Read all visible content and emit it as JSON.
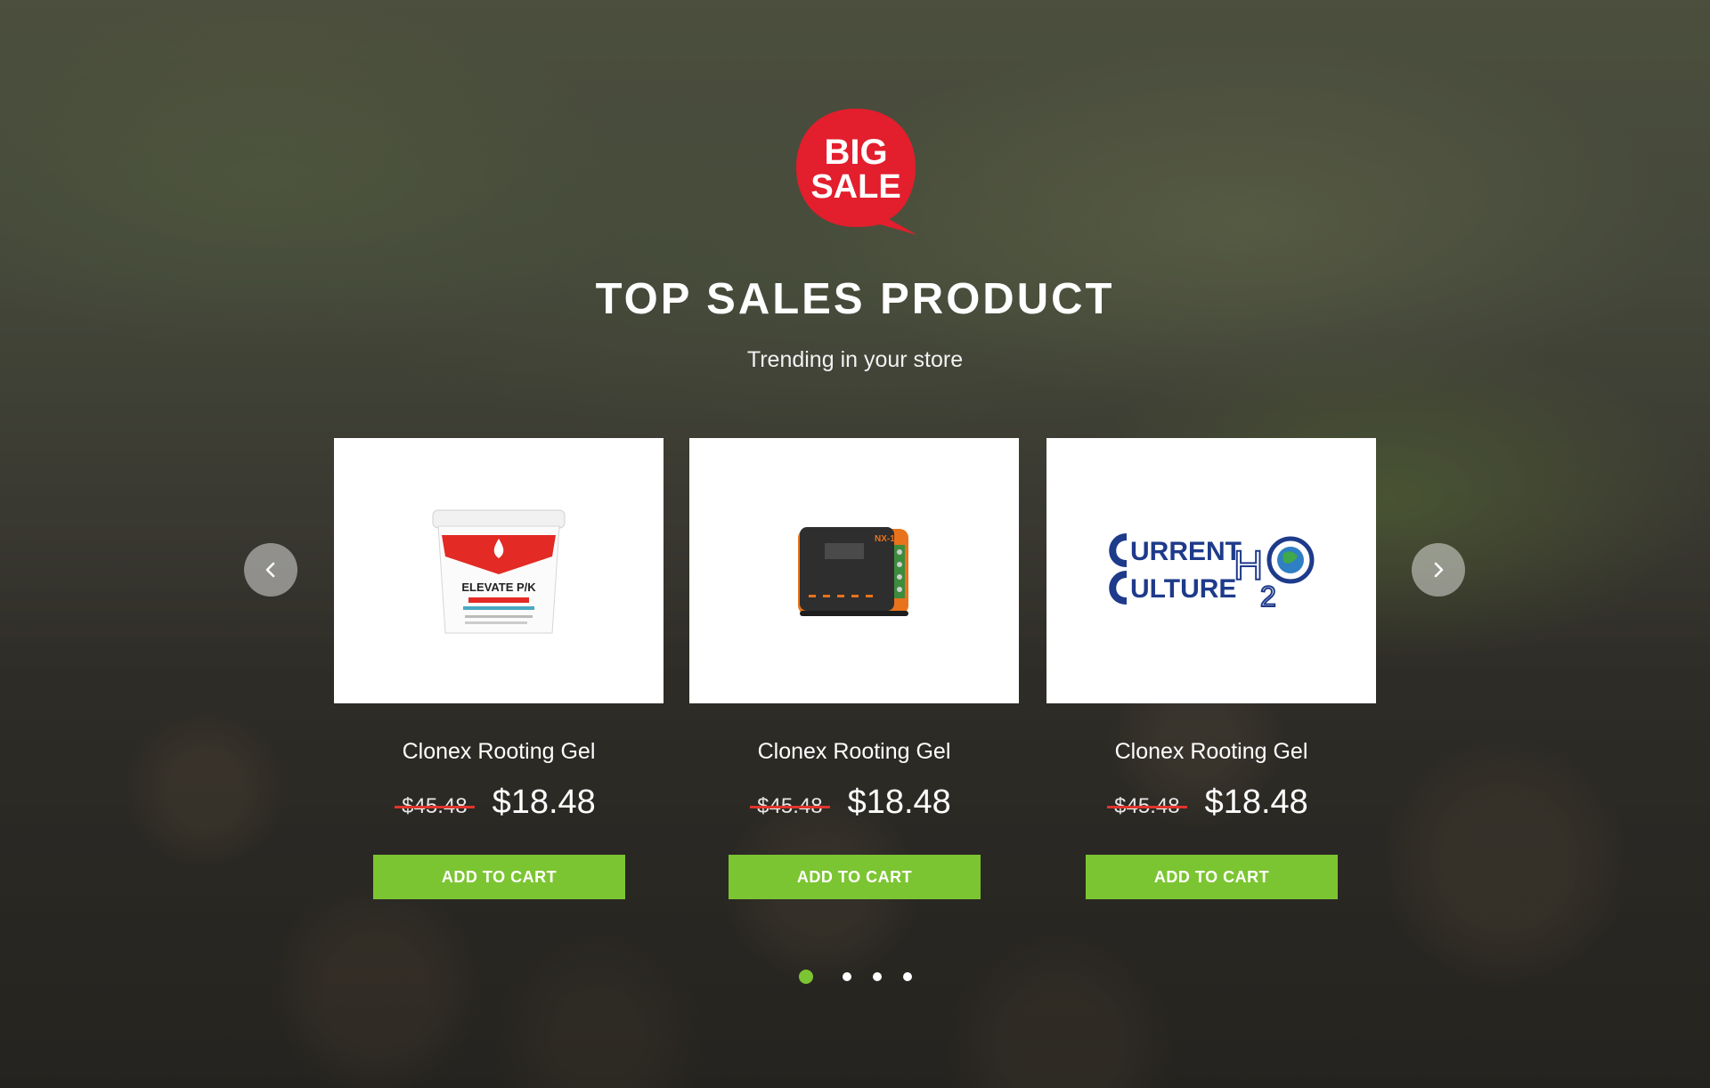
{
  "section": {
    "badge_line1": "BIG",
    "badge_line2": "SALE",
    "title": "TOP SALES PRODUCT",
    "subtitle": "Trending in your store"
  },
  "products": [
    {
      "name": "Clonex Rooting Gel",
      "old_price": "$45.48",
      "new_price": "$18.48",
      "cart_label": "ADD TO CART",
      "image_label": "ELEVATE P/K"
    },
    {
      "name": "Clonex Rooting Gel",
      "old_price": "$45.48",
      "new_price": "$18.48",
      "cart_label": "ADD TO CART",
      "image_label": "NX-1"
    },
    {
      "name": "Clonex Rooting Gel",
      "old_price": "$45.48",
      "new_price": "$18.48",
      "cart_label": "ADD TO CART",
      "image_label_1": "URRENT",
      "image_label_2": "ULTURE",
      "image_label_3": "H",
      "image_label_4": "2"
    }
  ],
  "carousel": {
    "prev_icon": "chevron-left-icon",
    "next_icon": "chevron-right-icon",
    "page_count": 4,
    "active_page": 1
  },
  "colors": {
    "accent": "#7cc532",
    "badge": "#e31e2d",
    "strike": "#e0342c"
  }
}
